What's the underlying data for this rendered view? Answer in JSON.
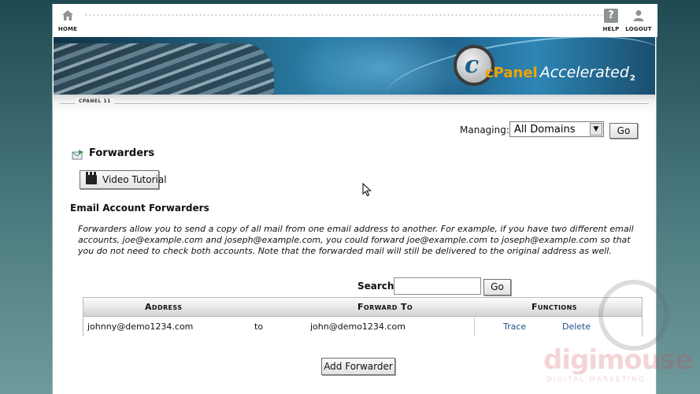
{
  "toolbar": {
    "home_label": "HOME",
    "help_label": "HELP",
    "logout_label": "LOGOUT"
  },
  "banner": {
    "logo_c": "c",
    "logo_brand": "cPanel",
    "logo_product": "Accelerated",
    "logo_version": "2"
  },
  "version_label": "CPANEL 11",
  "managing": {
    "label": "Managing:",
    "selected": "All Domains",
    "go_label": "Go"
  },
  "page": {
    "title": "Forwarders",
    "video_button": "Video Tutorial",
    "section_title": "Email Account Forwarders",
    "description": "Forwarders allow you to send a copy of all mail from one email address to another. For example, if you have two different email accounts, joe@example.com and joseph@example.com, you could forward joe@example.com to joseph@example.com so that you do not need to check both accounts. Note that the forwarded mail will still be delivered to the original address as well."
  },
  "search": {
    "label": "Search",
    "value": "",
    "go_label": "Go"
  },
  "table": {
    "headers": {
      "address": "Address",
      "forward_to": "Forward To",
      "functions": "Functions"
    },
    "rows": [
      {
        "address": "johnny@demo1234.com",
        "to": "to",
        "forward_to": "john@demo1234.com",
        "trace": "Trace",
        "delete": "Delete"
      }
    ]
  },
  "add_forwarder_label": "Add Forwarder",
  "watermark": {
    "name": "digimouse",
    "tagline": "DIGITAL MARKETING"
  },
  "icons": {
    "home": "home-icon",
    "help": "help-icon",
    "logout": "logout-icon",
    "forwarders": "mail-forward-icon",
    "video": "clapperboard-icon",
    "cursor": "mouse-cursor-icon"
  },
  "colors": {
    "link": "#1e4e8c",
    "logo_orange": "#f2a400",
    "banner_blue": "#2a7fa6"
  }
}
